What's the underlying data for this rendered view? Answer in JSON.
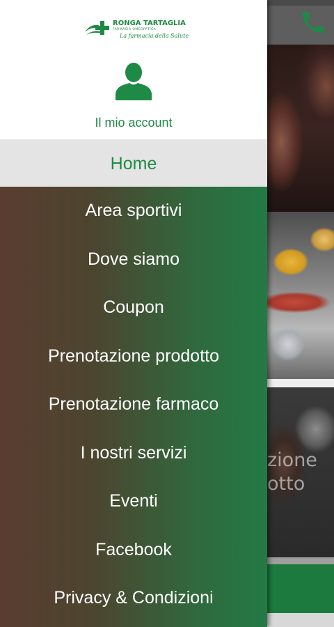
{
  "colors": {
    "brand_green": "#1f8a45",
    "drawer_gradient_left": "#5a3d30",
    "drawer_gradient_right": "#237a45",
    "active_item_bg": "#e4e4e4"
  },
  "header": {
    "logo_title": "RONGA TARTAGLIA",
    "logo_subtitle": "FARMACIA OMEOPATICA",
    "logo_tagline": "La farmacia della Salute",
    "account_label": "Il mio account",
    "account_icon": "user-avatar-icon"
  },
  "menu": {
    "items": [
      {
        "label": "Home",
        "active": true
      },
      {
        "label": "Area sportivi"
      },
      {
        "label": "Dove siamo"
      },
      {
        "label": "Coupon"
      },
      {
        "label": "Prenotazione prodotto"
      },
      {
        "label": "Prenotazione farmaco"
      },
      {
        "label": "I nostri servizi"
      },
      {
        "label": "Eventi"
      },
      {
        "label": "Facebook"
      },
      {
        "label": "Privacy & Condizioni"
      }
    ]
  },
  "background_app": {
    "call_icon": "phone-icon",
    "tile_text_partial": "zione\notto"
  }
}
